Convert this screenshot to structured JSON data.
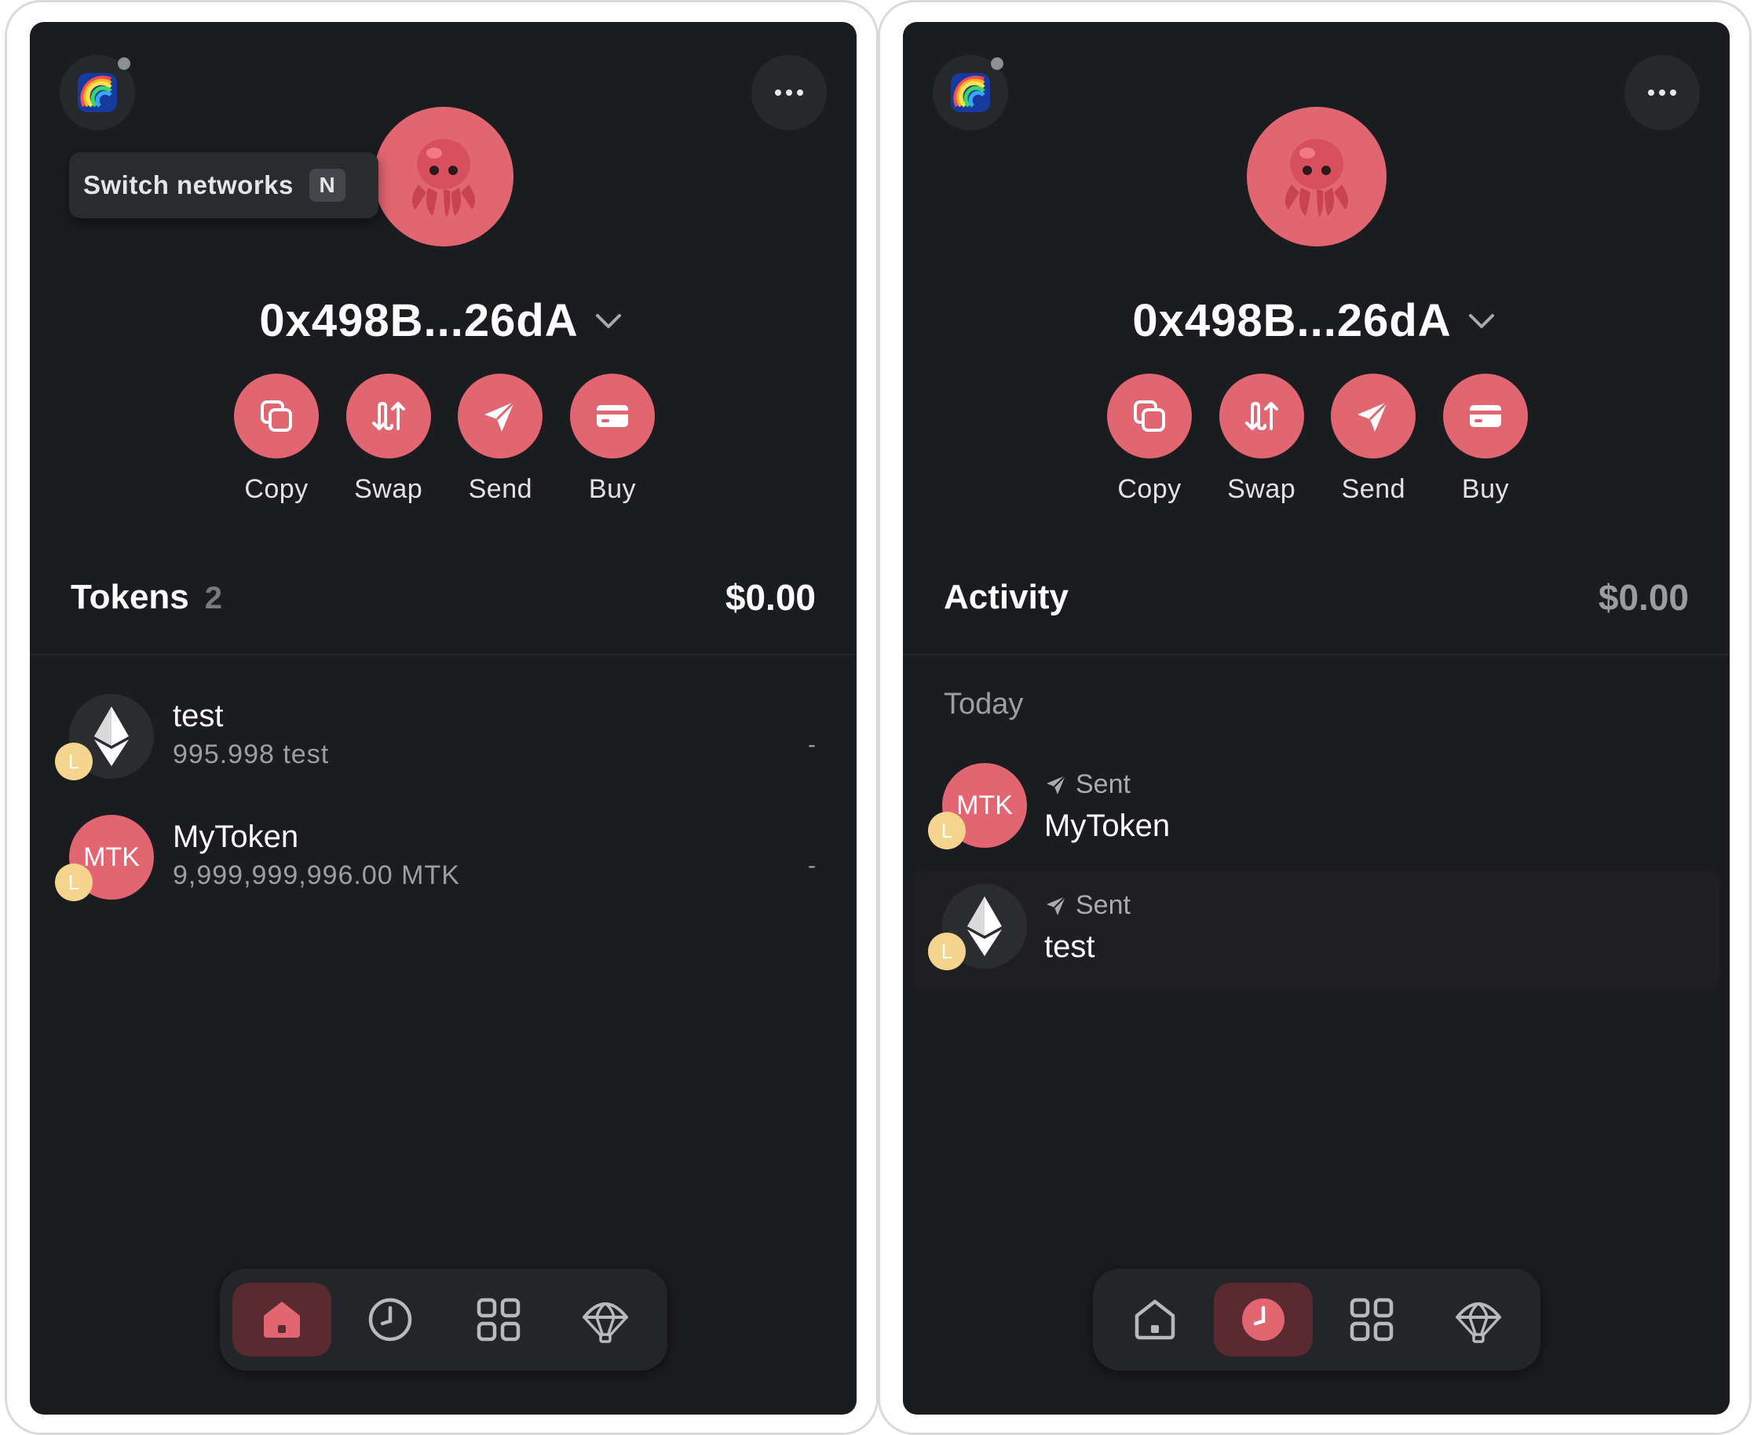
{
  "colors": {
    "accent": "#e26671",
    "panel_bg": "#1b1c1f",
    "muted_text": "#9c9ea3",
    "badge": "#f5d58d"
  },
  "panels": [
    {
      "network_icon": "rainbow-network-icon",
      "tooltip": {
        "text": "Switch networks",
        "shortcut": "N"
      },
      "avatar_icon": "octopus-emoji-icon",
      "address": "0x498B...26dA",
      "actions": [
        {
          "label": "Copy",
          "icon": "copy-icon"
        },
        {
          "label": "Swap",
          "icon": "swap-icon"
        },
        {
          "label": "Send",
          "icon": "send-icon"
        },
        {
          "label": "Buy",
          "icon": "card-icon"
        }
      ],
      "section": {
        "title": "Tokens",
        "count": "2",
        "total": "$0.00"
      },
      "tokens": [
        {
          "name": "test",
          "balance": "995.998 test",
          "value": "-",
          "icon": "ethereum-icon",
          "badge": "L"
        },
        {
          "name": "MyToken",
          "balance": "9,999,999,996.00 MTK",
          "value": "-",
          "symbol": "MTK",
          "badge": "L"
        }
      ],
      "nav": {
        "active": "home"
      }
    },
    {
      "network_icon": "rainbow-network-icon",
      "avatar_icon": "octopus-emoji-icon",
      "address": "0x498B...26dA",
      "actions": [
        {
          "label": "Copy",
          "icon": "copy-icon"
        },
        {
          "label": "Swap",
          "icon": "swap-icon"
        },
        {
          "label": "Send",
          "icon": "send-icon"
        },
        {
          "label": "Buy",
          "icon": "card-icon"
        }
      ],
      "section": {
        "title": "Activity",
        "total": "$0.00"
      },
      "activity": {
        "group_label": "Today",
        "items": [
          {
            "type": "Sent",
            "token": "MyToken",
            "symbol": "MTK",
            "badge": "L"
          },
          {
            "type": "Sent",
            "token": "test",
            "icon": "ethereum-icon",
            "badge": "L"
          }
        ]
      },
      "nav": {
        "active": "activity"
      }
    }
  ],
  "nav_items": [
    "home-icon",
    "clock-icon",
    "grid-icon",
    "parachute-icon"
  ]
}
